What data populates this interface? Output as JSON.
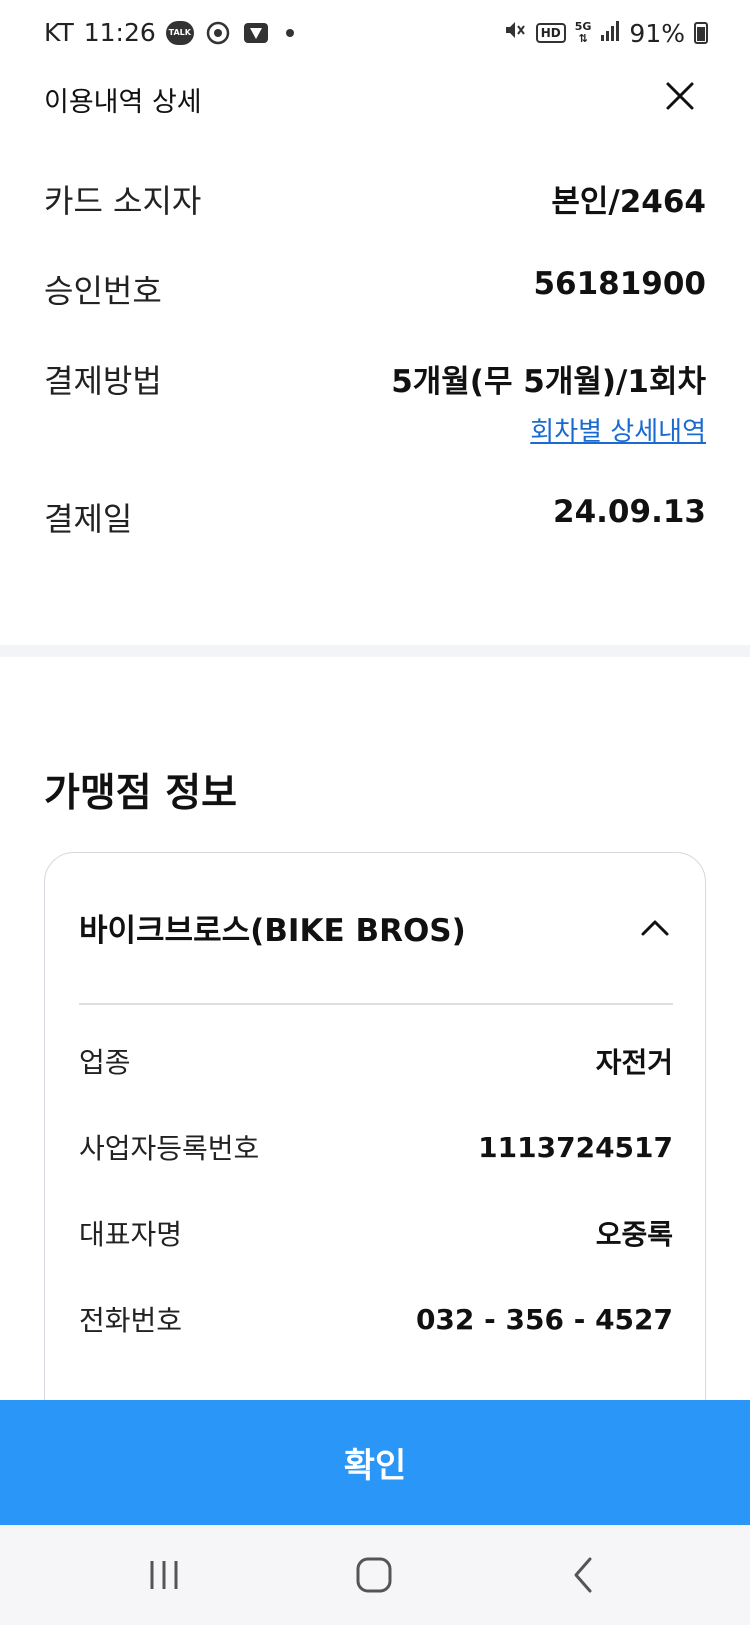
{
  "status_bar": {
    "carrier": "KT",
    "time": "11:26",
    "talk_badge": "TALK",
    "hd_badge": "HD",
    "network": "5G",
    "battery": "91%"
  },
  "header": {
    "title": "이용내역 상세"
  },
  "details": {
    "cardholder": {
      "label": "카드 소지자",
      "value": "본인/2464"
    },
    "approval": {
      "label": "승인번호",
      "value": "56181900"
    },
    "payment_method": {
      "label": "결제방법",
      "value": "5개월(무 5개월)/1회차",
      "link": "회차별 상세내역"
    },
    "payment_date": {
      "label": "결제일",
      "value": "24.09.13"
    }
  },
  "merchant": {
    "section_title": "가맹점 정보",
    "name": "바이크브로스(BIKE BROS)",
    "rows": [
      {
        "label": "업종",
        "value": "자전거"
      },
      {
        "label": "사업자등록번호",
        "value": "1113724517"
      },
      {
        "label": "대표자명",
        "value": "오중록"
      },
      {
        "label": "전화번호",
        "value": "032 - 356 - 4527"
      }
    ]
  },
  "confirm_label": "확인",
  "colors": {
    "primary": "#2a96f8",
    "link": "#1a6bd1",
    "divider_band": "#f3f4f8"
  }
}
